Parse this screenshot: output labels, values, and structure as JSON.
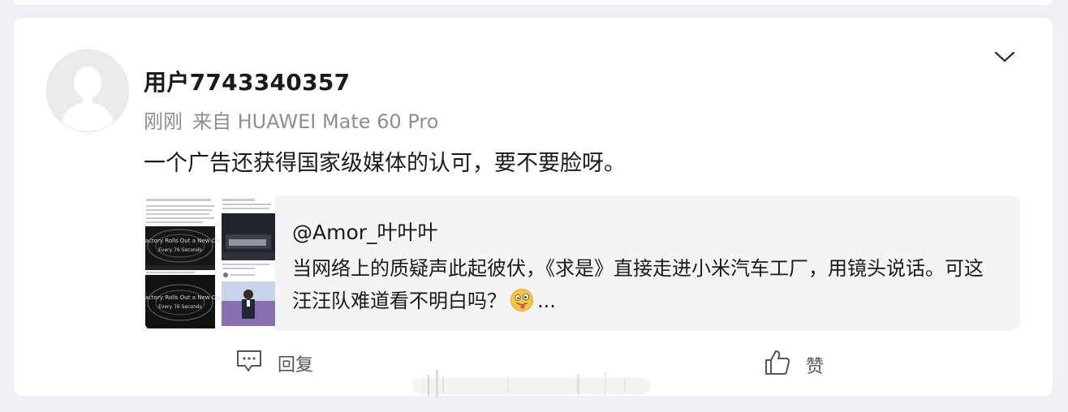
{
  "post": {
    "username": "用户7743340357",
    "time": "刚刚",
    "source": "来自 HUAWEI Mate 60 Pro",
    "content": "一个广告还获得国家级媒体的认可，要不要脸呀。"
  },
  "repost": {
    "author": "@Amor_叶叶叶",
    "text_before_emoji": "当网络上的质疑声此起彼伏，《求是》直接走进小米汽车工厂，用镜头说话。可这汪汪队难道看不明白吗？",
    "text_after_emoji": "...",
    "thumbnail_texts": {
      "line1": "i Factory Rolls Out a New Car",
      "line2": "Every 76 Seconds"
    }
  },
  "actions": {
    "reply_label": "回复",
    "like_label": "赞"
  },
  "icons": {
    "more": "chevron-down-icon",
    "reply": "comment-icon",
    "like": "thumbs-up-icon",
    "emoji": "tongue-face-emoji-icon"
  },
  "colors": {
    "page_bg": "#eef0f3",
    "card_bg": "#ffffff",
    "repost_bg": "#f4f4f6",
    "meta_text": "#8e8e93",
    "primary_text": "#1a1a1a"
  }
}
